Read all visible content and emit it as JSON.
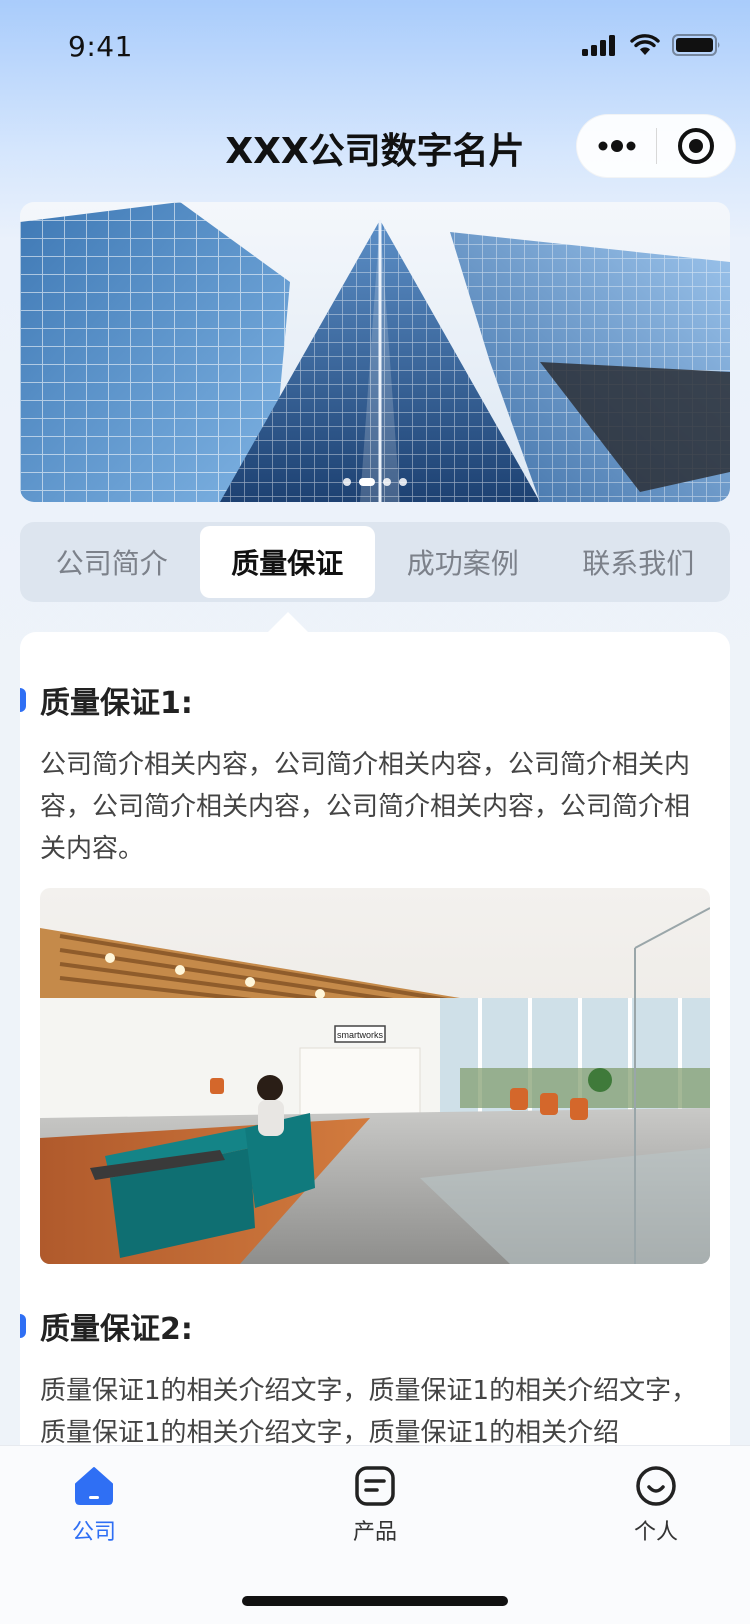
{
  "status_bar": {
    "time": "9:41"
  },
  "navbar": {
    "title": "XXX公司数字名片"
  },
  "banner": {
    "slide_count": 4,
    "active_index": 1
  },
  "tabs": [
    {
      "label": "公司简介",
      "active": false
    },
    {
      "label": "质量保证",
      "active": true
    },
    {
      "label": "成功案例",
      "active": false
    },
    {
      "label": "联系我们",
      "active": false
    }
  ],
  "content": {
    "sections": [
      {
        "title": "质量保证1:",
        "text": "公司简介相关内容，公司简介相关内容，公司简介相关内容，公司简介相关内容，公司简介相关内容，公司简介相关内容。",
        "image_sign": "smartworks"
      },
      {
        "title": "质量保证2:",
        "text": "质量保证1的相关介绍文字，质量保证1的相关介绍文字，质量保证1的相关介绍文字，质量保证1的相关介绍"
      }
    ]
  },
  "tabbar": {
    "items": [
      {
        "label": "公司",
        "icon": "home-icon",
        "active": true
      },
      {
        "label": "产品",
        "icon": "product-icon",
        "active": false
      },
      {
        "label": "个人",
        "icon": "profile-icon",
        "active": false
      }
    ]
  },
  "colors": {
    "accent": "#2f6ff4",
    "tab_bg": "#dde5ef"
  }
}
